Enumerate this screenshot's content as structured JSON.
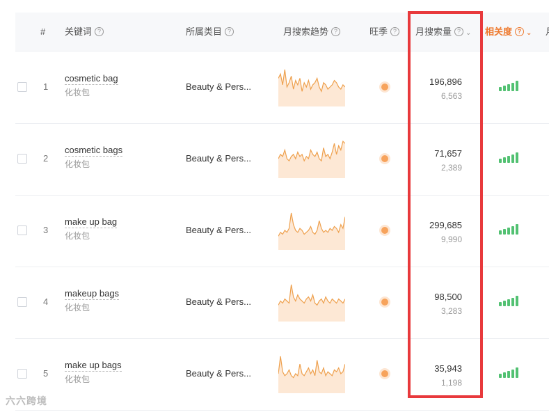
{
  "header": {
    "rank": "#",
    "keyword": "关键词",
    "category": "所属类目",
    "trend": "月搜索趋势",
    "season": "旺季",
    "volume": "月搜索量",
    "relevance": "相关度",
    "more": "月"
  },
  "rows": [
    {
      "rank": "1",
      "keyword_en": "cosmetic bag",
      "keyword_cn": "化妆包",
      "category": "Beauty & Pers...",
      "volume": "196,896",
      "sub_volume": "6,563",
      "trend": [
        12,
        14,
        9,
        16,
        8,
        10,
        13,
        7,
        11,
        9,
        12,
        6,
        10,
        8,
        11,
        7,
        9,
        10,
        12,
        8,
        6,
        10,
        9,
        7,
        8,
        9,
        11,
        10,
        8,
        7,
        9,
        8
      ]
    },
    {
      "rank": "2",
      "keyword_en": "cosmetic bags",
      "keyword_cn": "化妆包",
      "category": "Beauty & Pers...",
      "volume": "71,657",
      "sub_volume": "2,389",
      "trend": [
        8,
        10,
        9,
        12,
        8,
        7,
        9,
        10,
        8,
        11,
        9,
        10,
        7,
        9,
        8,
        12,
        10,
        9,
        11,
        8,
        7,
        13,
        9,
        10,
        8,
        11,
        15,
        10,
        14,
        12,
        16,
        15
      ]
    },
    {
      "rank": "3",
      "keyword_en": "make up bag",
      "keyword_cn": "化妆包",
      "category": "Beauty & Pers...",
      "volume": "299,685",
      "sub_volume": "9,990",
      "trend": [
        6,
        8,
        7,
        9,
        8,
        10,
        18,
        12,
        9,
        8,
        10,
        9,
        7,
        8,
        9,
        11,
        8,
        7,
        9,
        14,
        10,
        8,
        9,
        8,
        10,
        9,
        11,
        10,
        8,
        12,
        10,
        16
      ]
    },
    {
      "rank": "4",
      "keyword_en": "makeup bags",
      "keyword_cn": "化妆包",
      "category": "Beauty & Pers...",
      "volume": "98,500",
      "sub_volume": "3,283",
      "trend": [
        7,
        9,
        8,
        10,
        9,
        8,
        17,
        11,
        9,
        12,
        10,
        9,
        8,
        10,
        11,
        9,
        12,
        8,
        7,
        9,
        10,
        8,
        11,
        9,
        8,
        10,
        9,
        8,
        10,
        9,
        8,
        10
      ]
    },
    {
      "rank": "5",
      "keyword_en": "make up bags",
      "keyword_cn": "化妆包",
      "category": "Beauty & Pers...",
      "volume": "35,943",
      "sub_volume": "1,198",
      "trend": [
        9,
        18,
        10,
        8,
        9,
        11,
        8,
        7,
        9,
        8,
        14,
        9,
        8,
        10,
        12,
        9,
        11,
        8,
        16,
        10,
        9,
        12,
        8,
        10,
        9,
        8,
        11,
        10,
        12,
        9,
        10,
        14
      ]
    }
  ],
  "colors": {
    "accent": "#ee7a2f",
    "highlight": "#e8393c",
    "trend_line": "#eea04d",
    "trend_fill": "#fde8d5",
    "relevance": "#52c172"
  },
  "watermark": "六六跨境"
}
